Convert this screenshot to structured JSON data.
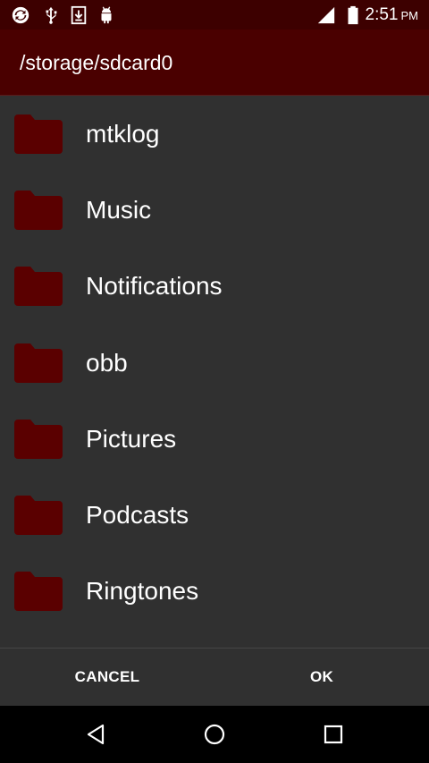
{
  "status_bar": {
    "icons": [
      "sync-icon",
      "usb-icon",
      "download-icon",
      "android-debug-icon",
      "signal-icon",
      "battery-icon"
    ],
    "time": "2:51",
    "ampm": "PM"
  },
  "app_bar": {
    "path": "/storage/sdcard0"
  },
  "folders": [
    {
      "name": "mtklog",
      "icon": "folder-icon"
    },
    {
      "name": "Music",
      "icon": "folder-icon"
    },
    {
      "name": "Notifications",
      "icon": "folder-icon"
    },
    {
      "name": "obb",
      "icon": "folder-icon"
    },
    {
      "name": "Pictures",
      "icon": "folder-icon"
    },
    {
      "name": "Podcasts",
      "icon": "folder-icon"
    },
    {
      "name": "Ringtones",
      "icon": "folder-icon"
    }
  ],
  "footer": {
    "cancel_label": "CANCEL",
    "ok_label": "OK"
  },
  "nav_bar": {
    "icons": [
      "back-icon",
      "home-icon",
      "recents-icon"
    ]
  },
  "colors": {
    "accent": "#4a0000",
    "status_bar": "#3d0000",
    "folder": "#5a0000",
    "background": "#303030"
  }
}
